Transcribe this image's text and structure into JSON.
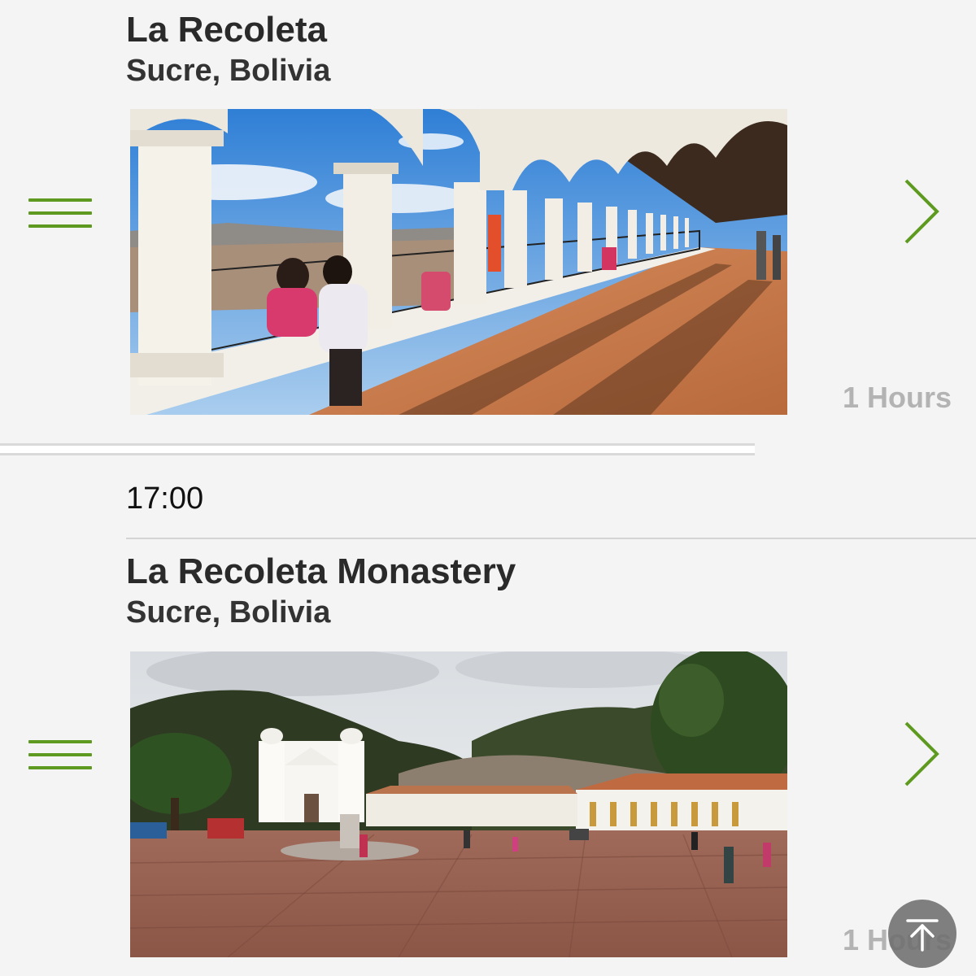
{
  "items": [
    {
      "title": "La Recoleta",
      "location": "Sucre, Bolivia",
      "duration": "1 Hours",
      "image_alt": "Arched colonnade balcony overlooking Sucre"
    },
    {
      "title": "La Recoleta Monastery",
      "location": "Sucre, Bolivia",
      "duration": "1 Hours",
      "image_alt": "White monastery and plaza beneath green hills"
    }
  ],
  "separator": {
    "time": "17:00"
  },
  "icons": {
    "drag": "drag-handle-icon",
    "next": "chevron-right-icon",
    "scroll_top": "scroll-to-top-icon"
  },
  "colors": {
    "accent": "#5e9a1f",
    "background": "#f4f4f4",
    "duration_text": "#b3b3b3"
  }
}
